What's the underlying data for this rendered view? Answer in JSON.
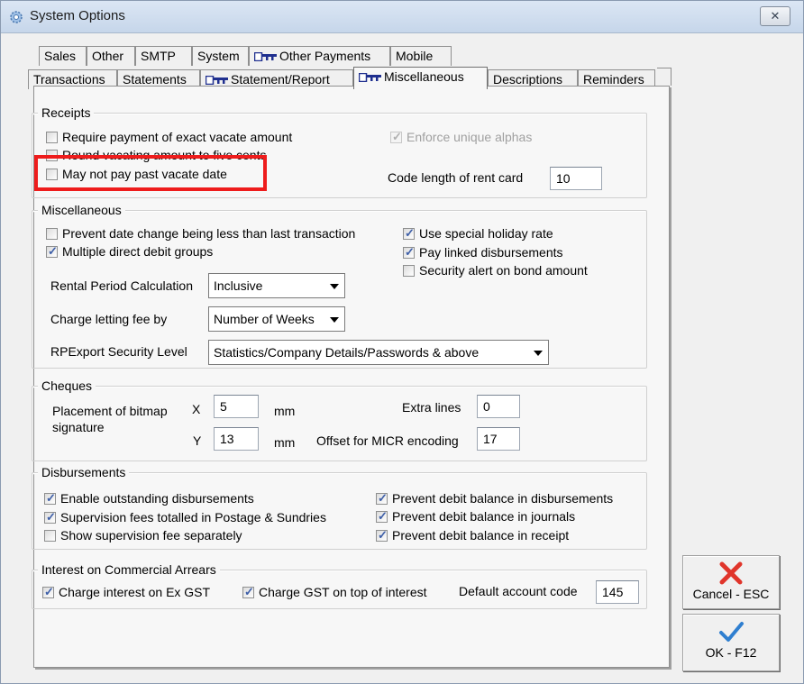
{
  "window": {
    "title": "System Options",
    "close_label": "✕"
  },
  "tabs_row1": [
    {
      "label": "Sales",
      "key": false
    },
    {
      "label": "Other",
      "key": false
    },
    {
      "label": "SMTP",
      "key": false
    },
    {
      "label": "System",
      "key": false
    },
    {
      "label": "Other Payments",
      "key": true
    },
    {
      "label": "Mobile",
      "key": false
    }
  ],
  "tabs_row2": [
    {
      "label": "Transactions",
      "key": false
    },
    {
      "label": "Statements",
      "key": false
    },
    {
      "label": "Statement/Report",
      "key": true
    },
    {
      "label": "Miscellaneous",
      "key": true,
      "active": true
    },
    {
      "label": "Descriptions",
      "key": false
    },
    {
      "label": "Reminders",
      "key": false
    }
  ],
  "receipts": {
    "title": "Receipts",
    "exact_vacate": {
      "label": "Require payment of exact vacate amount",
      "checked": false
    },
    "round_vacating": {
      "label": "Round vacating amount to five cents",
      "checked": false
    },
    "past_vacate": {
      "label": "May not pay past vacate date",
      "checked": false
    },
    "unique_alphas": {
      "label": "Enforce unique alphas",
      "checked": true,
      "disabled": true
    },
    "code_length_label": "Code length of rent card",
    "code_length_value": "10"
  },
  "misc": {
    "title": "Miscellaneous",
    "prevent_date": {
      "label": "Prevent date change being less than last transaction",
      "checked": false
    },
    "multi_debit": {
      "label": "Multiple direct debit groups",
      "checked": true
    },
    "holiday_rate": {
      "label": "Use special holiday rate",
      "checked": true
    },
    "linked_disb": {
      "label": "Pay linked disbursements",
      "checked": true
    },
    "bond_alert": {
      "label": "Security alert on bond amount",
      "checked": false
    },
    "rental_period_label": "Rental Period Calculation",
    "rental_period_value": "Inclusive",
    "letting_fee_label": "Charge letting fee by",
    "letting_fee_value": "Number of Weeks",
    "rpexport_label": "RPExport Security Level",
    "rpexport_value": "Statistics/Company Details/Passwords & above"
  },
  "cheques": {
    "title": "Cheques",
    "bitmap_label_1": "Placement of bitmap",
    "bitmap_label_2": "signature",
    "x_label": "X",
    "x_value": "5",
    "y_label": "Y",
    "y_value": "13",
    "mm": "mm",
    "extra_lines_label": "Extra lines",
    "extra_lines_value": "0",
    "micr_label": "Offset for MICR encoding",
    "micr_value": "17"
  },
  "disbursements": {
    "title": "Disbursements",
    "enable_outstanding": {
      "label": "Enable outstanding disbursements",
      "checked": true
    },
    "supervision_totalled": {
      "label": "Supervision fees totalled in Postage & Sundries",
      "checked": true
    },
    "supervision_separate": {
      "label": "Show supervision fee separately",
      "checked": false
    },
    "debit_disb": {
      "label": "Prevent debit balance in disbursements",
      "checked": true
    },
    "debit_journals": {
      "label": "Prevent debit balance in journals",
      "checked": true
    },
    "debit_receipt": {
      "label": "Prevent debit balance in receipt",
      "checked": true
    }
  },
  "interest": {
    "title": "Interest on Commercial Arrears",
    "ex_gst": {
      "label": "Charge interest on Ex GST",
      "checked": true
    },
    "gst_top": {
      "label": "Charge GST on top of interest",
      "checked": true
    },
    "default_code_label": "Default account code",
    "default_code_value": "145"
  },
  "buttons": {
    "cancel": "Cancel - ESC",
    "ok": "OK - F12"
  },
  "colors": {
    "highlight": "#ee1c1c",
    "cancel_icon": "#e0352b",
    "ok_icon": "#2f7fd0"
  }
}
